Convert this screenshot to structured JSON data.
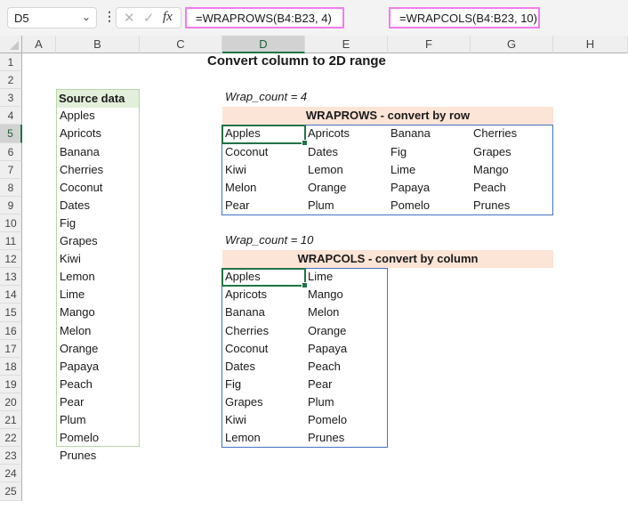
{
  "formula_bar": {
    "name_box": "D5",
    "formula_wraprows": "=WRAPROWS(B4:B23, 4)",
    "formula_wrapcols": "=WRAPCOLS(B4:B23, 10)",
    "icons": {
      "cancel": "✕",
      "enter": "✓",
      "fx": "fx",
      "chevron": "⌄",
      "dots": "⋮"
    }
  },
  "columns": [
    "A",
    "B",
    "C",
    "D",
    "E",
    "F",
    "G",
    "H"
  ],
  "selected_column": "D",
  "rows": [
    "1",
    "2",
    "3",
    "4",
    "5",
    "6",
    "7",
    "8",
    "9",
    "10",
    "11",
    "12",
    "13",
    "14",
    "15",
    "16",
    "17",
    "18",
    "19",
    "20",
    "21",
    "22",
    "23",
    "24",
    "25"
  ],
  "selected_row": "5",
  "sheet": {
    "title": "Convert column to 2D range",
    "source_header": "Source data",
    "source_data": [
      "Apples",
      "Apricots",
      "Banana",
      "Cherries",
      "Coconut",
      "Dates",
      "Fig",
      "Grapes",
      "Kiwi",
      "Lemon",
      "Lime",
      "Mango",
      "Melon",
      "Orange",
      "Papaya",
      "Peach",
      "Pear",
      "Plum",
      "Pomelo",
      "Prunes"
    ],
    "wraprows": {
      "label": "Wrap_count = 4",
      "header": "WRAPROWS - convert by row",
      "rows": [
        [
          "Apples",
          "Apricots",
          "Banana",
          "Cherries"
        ],
        [
          "Coconut",
          "Dates",
          "Fig",
          "Grapes"
        ],
        [
          "Kiwi",
          "Lemon",
          "Lime",
          "Mango"
        ],
        [
          "Melon",
          "Orange",
          "Papaya",
          "Peach"
        ],
        [
          "Pear",
          "Plum",
          "Pomelo",
          "Prunes"
        ]
      ]
    },
    "wrapcols": {
      "label": "Wrap_count = 10",
      "header": "WRAPCOLS - convert by column",
      "rows": [
        [
          "Apples",
          "Lime"
        ],
        [
          "Apricots",
          "Mango"
        ],
        [
          "Banana",
          "Melon"
        ],
        [
          "Cherries",
          "Orange"
        ],
        [
          "Coconut",
          "Papaya"
        ],
        [
          "Dates",
          "Peach"
        ],
        [
          "Fig",
          "Pear"
        ],
        [
          "Grapes",
          "Plum"
        ],
        [
          "Kiwi",
          "Pomelo"
        ],
        [
          "Lemon",
          "Prunes"
        ]
      ]
    }
  },
  "colors": {
    "selection": "#217346",
    "spill_border": "#4472c4",
    "header_band": "#fce4d6",
    "source_header": "#e2efda",
    "formula_highlight": "#f27cf0"
  }
}
